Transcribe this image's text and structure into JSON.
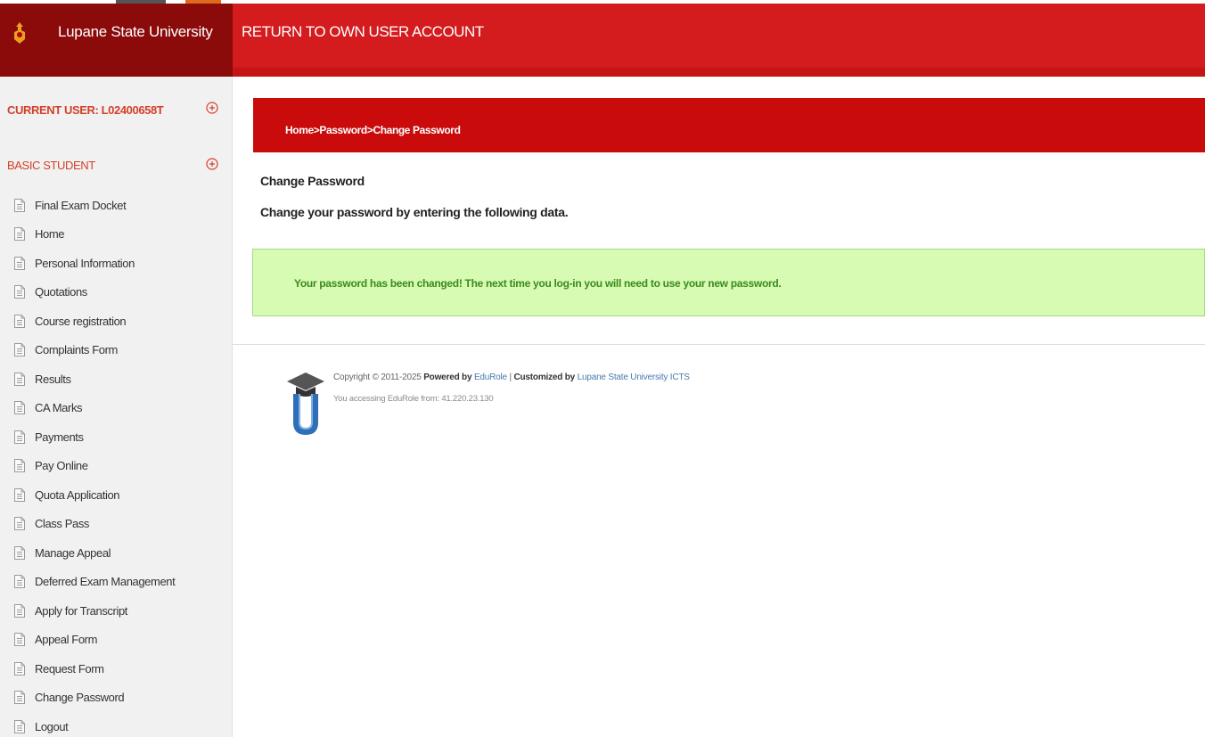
{
  "brand": {
    "title": "Lupane State University"
  },
  "header": {
    "return_link": "RETURN TO OWN USER ACCOUNT"
  },
  "sidebar": {
    "current_user": "CURRENT USER: L02400658T",
    "section_title": "BASIC STUDENT",
    "items": [
      {
        "label": "Final Exam Docket"
      },
      {
        "label": "Home"
      },
      {
        "label": "Personal Information"
      },
      {
        "label": "Quotations"
      },
      {
        "label": "Course registration"
      },
      {
        "label": "Complaints Form"
      },
      {
        "label": "Results"
      },
      {
        "label": "CA Marks"
      },
      {
        "label": "Payments"
      },
      {
        "label": "Pay Online"
      },
      {
        "label": "Quota Application"
      },
      {
        "label": "Class Pass"
      },
      {
        "label": "Manage Appeal"
      },
      {
        "label": "Deferred Exam Management"
      },
      {
        "label": "Apply for Transcript"
      },
      {
        "label": "Appeal Form"
      },
      {
        "label": "Request Form"
      },
      {
        "label": "Change Password"
      },
      {
        "label": "Logout"
      }
    ]
  },
  "breadcrumb": {
    "home": "Home",
    "sep": ">",
    "password": "Password",
    "current": "Change Password"
  },
  "main": {
    "title": "Change Password",
    "subtitle": "Change your password by entering the following data.",
    "success_message": "Your password has been changed! The next time you log-in you will need to use your new password."
  },
  "footer": {
    "copyright_prefix": "Copyright © 2011-2025",
    "powered_by": "Powered by",
    "powered_link": "EduRole",
    "sep": "|",
    "customized_by": "Customized by",
    "customized_link": "Lupane State University ICTS",
    "access_text": "You accessing EduRole from: 41.220.23.130"
  },
  "colors": {
    "header_red": "#d41b1e",
    "brand_dark": "#8b0a0a",
    "breadcrumb_red": "#c90b0b",
    "success_bg": "#d7fbb2",
    "success_text": "#3b8a1e",
    "sidebar_accent": "#d3402a"
  }
}
